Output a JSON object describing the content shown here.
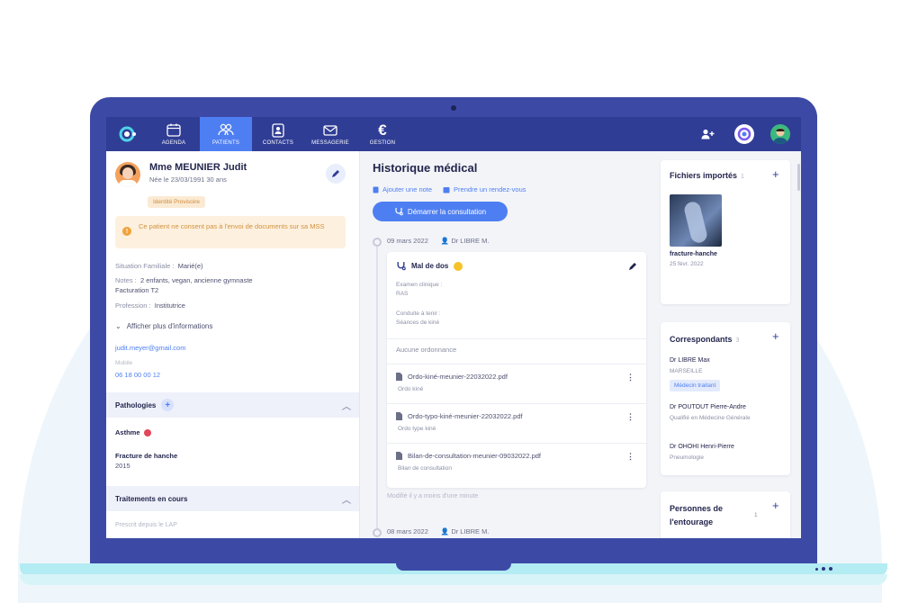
{
  "nav": {
    "items": [
      {
        "label": "AGENDA",
        "icon": "calendar-icon"
      },
      {
        "label": "PATIENTS",
        "icon": "users-icon"
      },
      {
        "label": "CONTACTS",
        "icon": "contacts-icon"
      },
      {
        "label": "MESSAGERIE",
        "icon": "mail-icon"
      },
      {
        "label": "GESTION",
        "icon": "euro-icon"
      }
    ],
    "active": "PATIENTS"
  },
  "patient": {
    "name": "Mme MEUNIER Judit",
    "birth": "Née le 23/03/1991 30 ans",
    "identity_badge": "Identité Provisoire",
    "warning": "Ce patient ne consent pas à l'envoi de documents sur sa MSS",
    "family_key": "Situation Familiale :",
    "family_val": "Marié(e)",
    "notes_key": "Notes :",
    "notes_val": "2 enfants, vegan, ancienne gymnaste",
    "notes_val2": "Facturation T2",
    "profession_key": "Profession :",
    "profession_val": "Institutrice",
    "more_info": "Afficher plus d'informations",
    "email": "judit.meyer@gmail.com",
    "mobile_label": "Mobile",
    "mobile": "06 18 00 00 12"
  },
  "pathologies": {
    "title": "Pathologies",
    "items": [
      {
        "name": "Asthme",
        "sub": ""
      },
      {
        "name": "Fracture de hanche",
        "sub": "2015"
      }
    ]
  },
  "treatments": {
    "title": "Traitements en cours",
    "prescribed": "Prescrit depuis le LAP"
  },
  "history": {
    "title": "Historique médical",
    "add_note": "Ajouter une note",
    "appointment": "Prendre un rendez-vous",
    "start_consult": "Démarrer la consultation",
    "entries": [
      {
        "date": "09 mars 2022",
        "doctor": "Dr LIBRE M."
      },
      {
        "date": "08 mars 2022",
        "doctor": "Dr LIBRE M."
      }
    ],
    "card": {
      "title": "Mal de dos",
      "exam_label": "Examen clinique :",
      "exam_val": "RAS",
      "conduct_label": "Conduite à tenir :",
      "conduct_val": "Séances de kiné",
      "no_prescription": "Aucune ordonnance",
      "docs": [
        {
          "name": "Ordo-kiné-meunier-22032022.pdf",
          "type": "Ordo kiné"
        },
        {
          "name": "Ordo-typo-kiné-meunier-22032022.pdf",
          "type": "Ordo type kiné"
        },
        {
          "name": "Bilan-de-consultation-meunier-09032022.pdf",
          "type": "Bilan de consultation"
        }
      ]
    },
    "modified": "Modifié il y a moins d'une minute"
  },
  "files": {
    "title": "Fichiers importés",
    "count": "1",
    "file_name": "fracture-hanche",
    "file_date": "25 févr. 2022"
  },
  "correspondents": {
    "title": "Correspondants",
    "count": "3",
    "items": [
      {
        "name": "Dr LIBRE Max",
        "detail": "MARSEILLE",
        "badge": "Médecin traitant"
      },
      {
        "name": "Dr POUTOUT Pierre-Andre",
        "detail": "Qualifié en Médecine Générale",
        "badge": ""
      },
      {
        "name": "Dr OHOHI Henri-Pierre",
        "detail": "Pneumologie",
        "badge": ""
      }
    ]
  },
  "entourage": {
    "title": "Personnes de l'entourage",
    "count": "1"
  },
  "colors": {
    "primary": "#4e7ff2",
    "nav_bg": "#2f3d95",
    "laptop": "#3c4aa6"
  }
}
